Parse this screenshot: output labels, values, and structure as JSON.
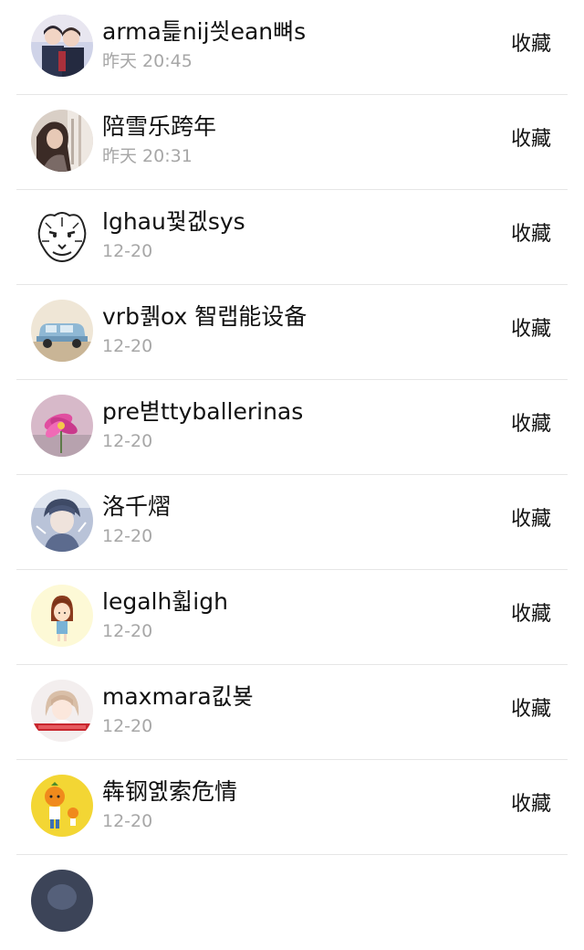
{
  "action_label": "收藏",
  "items": [
    {
      "name": "arma틅nij씟ean뼈s",
      "time": "昨天 20:45",
      "avatar": "photo-avatar-couple"
    },
    {
      "name": "陪雪乐跨年",
      "time": "昨天 20:31",
      "avatar": "photo-avatar-portrait"
    },
    {
      "name": "lghau꿫겞sys",
      "time": "12-20",
      "avatar": "tiger-sketch-avatar"
    },
    {
      "name": "vrb퀡ox 智랩能设备",
      "time": "12-20",
      "avatar": "blue-car-avatar"
    },
    {
      "name": "pre볃ttyballerinas",
      "time": "12-20",
      "avatar": "pink-flower-avatar"
    },
    {
      "name": "洛千熠",
      "time": "12-20",
      "avatar": "anime-boy-avatar"
    },
    {
      "name": "legalh휣igh",
      "time": "12-20",
      "avatar": "cartoon-girl-avatar"
    },
    {
      "name": "maxmara킶뵺",
      "time": "12-20",
      "avatar": "anime-girl-avatar"
    },
    {
      "name": "犇钢옔索危情",
      "time": "12-20",
      "avatar": "orange-mascot-avatar"
    }
  ]
}
